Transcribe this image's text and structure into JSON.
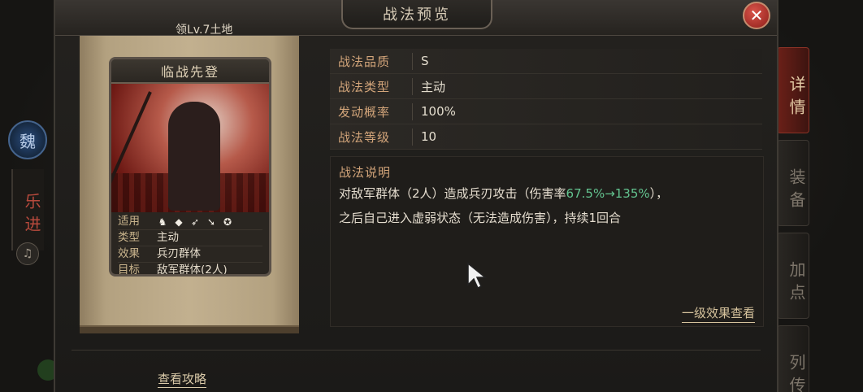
{
  "dialog": {
    "title": "战法预览",
    "territory": "领Lv.7土地",
    "close_icon": "close-icon"
  },
  "left_panel": {
    "faction": "魏",
    "hero_name": "乐进"
  },
  "right_tabs": [
    "详情",
    "装备",
    "加点",
    "列传"
  ],
  "card": {
    "name": "临战先登",
    "rows": [
      {
        "key": "适用",
        "icons": [
          "cavalry-icon",
          "shield-icon",
          "bow-icon",
          "spear-icon",
          "chariot-icon"
        ]
      },
      {
        "key": "类型",
        "value": "主动"
      },
      {
        "key": "效果",
        "value": "兵刃群体"
      },
      {
        "key": "目标",
        "value": "敌军群体(2人)"
      }
    ]
  },
  "attributes": [
    {
      "key": "战法品质",
      "value": "S"
    },
    {
      "key": "战法类型",
      "value": "主动"
    },
    {
      "key": "发动概率",
      "value": "100%"
    },
    {
      "key": "战法等级",
      "value": "10"
    }
  ],
  "description": {
    "title": "战法说明",
    "line1_pre": "对敌军群体（2人）造成兵刃攻击（伤害率",
    "line1_rate": "67.5%→135%",
    "line1_post": "），",
    "line2": "之后自己进入虚弱状态（无法造成伤害），持续1回合",
    "effect_link": "一级效果查看"
  },
  "guide_link": "查看攻略",
  "colors": {
    "accent_key": "#d3a57a",
    "rate_green": "#63c38f",
    "close_red": "#d9544a"
  }
}
